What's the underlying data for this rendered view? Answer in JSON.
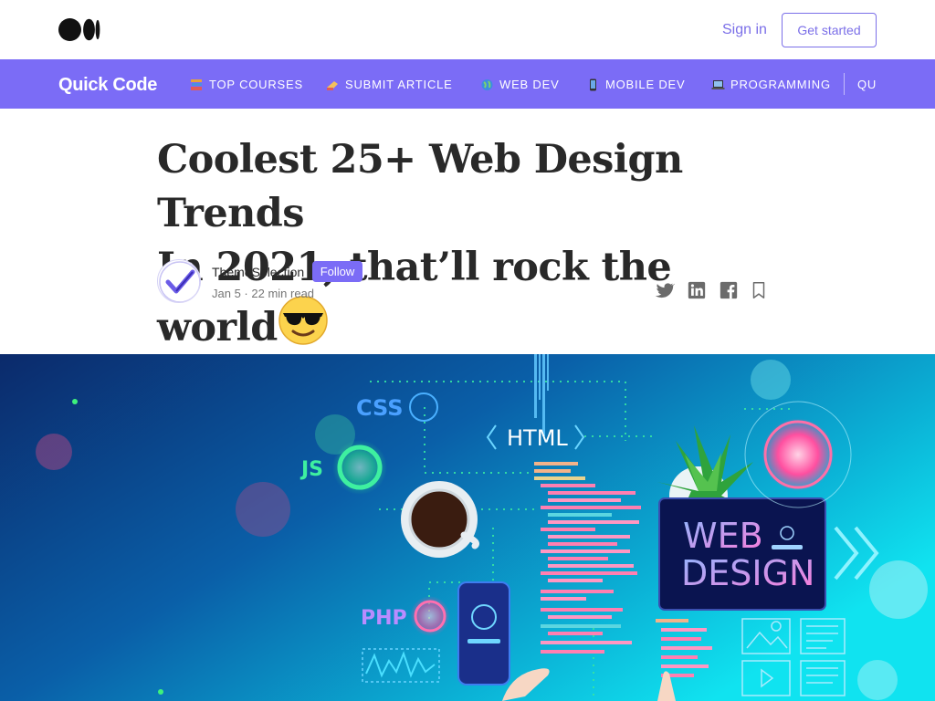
{
  "header": {
    "sign_in": "Sign in",
    "get_started": "Get started"
  },
  "publication": {
    "name": "Quick Code",
    "nav": [
      {
        "label": "TOP COURSES",
        "icon": "books-icon"
      },
      {
        "label": "SUBMIT ARTICLE",
        "icon": "writing-hand-icon"
      },
      {
        "label": "WEB DEV",
        "icon": "globe-icon"
      },
      {
        "label": "MOBILE DEV",
        "icon": "mobile-phone-icon"
      },
      {
        "label": "PROGRAMMING",
        "icon": "laptop-icon"
      },
      {
        "label": "QU"
      }
    ]
  },
  "article": {
    "title_line1": "Coolest 25+ Web Design Trends",
    "title_line2": "In 2021, that’ll rock the world",
    "title_emoji": "smiling-face-with-sunglasses-icon",
    "author": "ThemeSelection",
    "follow": "Follow",
    "date": "Jan 5",
    "read_time": "22 min read"
  },
  "hero": {
    "labels": {
      "css": "CSS",
      "html": "HTML",
      "js": "JS",
      "php": "PHP",
      "web": "WEB",
      "design": "DESIGN"
    }
  },
  "colors": {
    "accent": "#7b6cf6",
    "text": "#292929",
    "meta": "#757575"
  }
}
